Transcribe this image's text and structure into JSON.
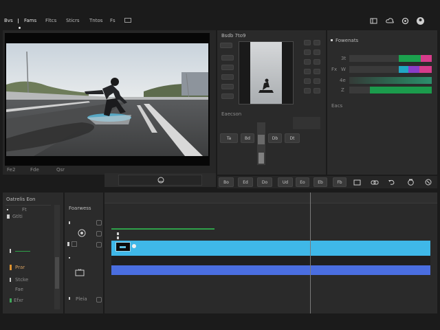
{
  "menu": [
    "Bvs",
    "Fams",
    "Fltcs",
    "Sticrs",
    "Tntos",
    "Fs"
  ],
  "topbar_icons": [
    "panel-layout-icon",
    "cloud-icon",
    "settings-icon",
    "user-icon"
  ],
  "preview": {
    "labels": [
      "Fe2",
      "Fde",
      "Qsr"
    ],
    "playhead_icon": "timecode-icon"
  },
  "source_panel": {
    "title": "Bsdb 7to9",
    "section_label": "Eaecson",
    "buttons": [
      "Ta",
      "Bd",
      "Db",
      "Dt"
    ]
  },
  "inspector": {
    "title": "Fowenats",
    "bars": [
      {
        "label": "3t",
        "colors": [
          "#1ba14e",
          "#d63c8b"
        ]
      },
      {
        "label": "W",
        "prefix": "Fx",
        "colors": [
          "#21a7c4",
          "#8a3ec8",
          "#d63c8b"
        ]
      },
      {
        "label": "4e",
        "colors": [
          "#2c8f6d"
        ]
      },
      {
        "label": "Z",
        "colors": [
          "#1b9b4c"
        ]
      }
    ],
    "section_label": "Eacs"
  },
  "toolbar": {
    "buttons": [
      "Bo",
      "Ed",
      "Do",
      "Ud",
      "Eo",
      "Eb",
      "Fb"
    ],
    "icons": [
      "marker-icon",
      "link-icon",
      "undo-icon",
      "snapshot-icon",
      "fit-icon"
    ]
  },
  "left_panel": {
    "title": "Oatrelis Eon",
    "items": [
      {
        "label": "Ft"
      },
      {
        "label": "Gtlti"
      },
      {
        "label": ""
      },
      {
        "label": "Prar",
        "accent": "#e0932e"
      },
      {
        "label": "Stcke"
      },
      {
        "label": "Fae"
      },
      {
        "label": "Efxr"
      }
    ]
  },
  "media_panel": {
    "title": "Foarwess",
    "footer": "Pleia"
  },
  "timeline": {
    "colors": {
      "video": "#3fb8e8",
      "audio": "#4a6ee0",
      "selection": "#2fa24a"
    }
  }
}
